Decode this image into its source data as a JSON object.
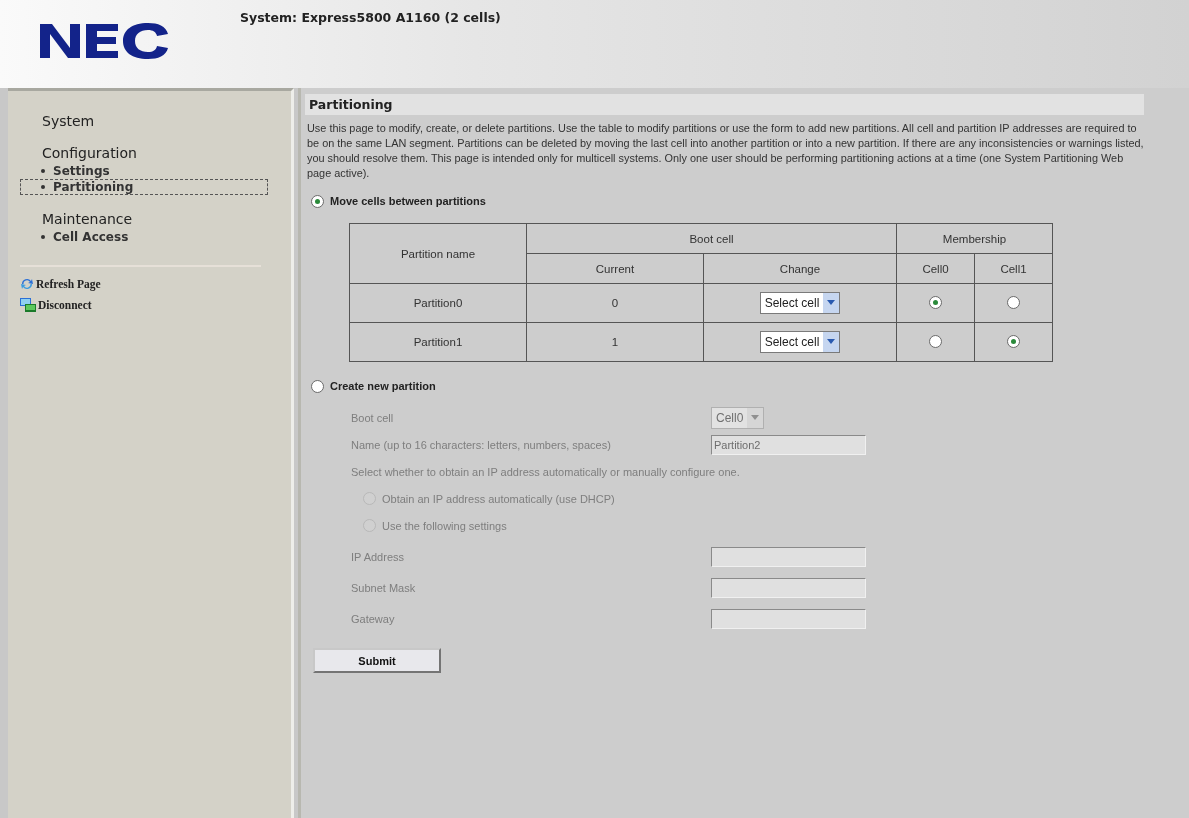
{
  "header": {
    "system_title": "System: Express5800 A1160 (2 cells)"
  },
  "sidebar": {
    "sections": [
      {
        "title": "System"
      },
      {
        "title": "Configuration",
        "items": [
          {
            "label": "Settings",
            "selected": false
          },
          {
            "label": "Partitioning",
            "selected": true
          }
        ]
      },
      {
        "title": "Maintenance",
        "items": [
          {
            "label": "Cell Access",
            "selected": false
          }
        ]
      }
    ],
    "actions": [
      {
        "label": "Refresh Page",
        "kind": "refresh"
      },
      {
        "label": "Disconnect",
        "kind": "disconnect"
      }
    ]
  },
  "main": {
    "heading": "Partitioning",
    "description": "Use this page to modify, create, or delete partitions. Use the table to modify partitions or use the form to add new partitions. All cell and partition IP addresses are required to be on the same LAN segment. Partitions can be deleted by moving the last cell into another partition or into a new partition. If there are any inconsistencies or warnings listed, you should resolve them. This page is intended only for multicell systems. Only one user should be performing partitioning actions at a time (one System Partitioning Web page active).",
    "move_option": {
      "label": "Move cells between partitions",
      "selected": true
    },
    "table": {
      "name_header": "Partition name",
      "boot_header": "Boot cell",
      "membership_header": "Membership",
      "current_header": "Current",
      "change_header": "Change",
      "cell_headers": [
        "Cell0",
        "Cell1"
      ],
      "rows": [
        {
          "name": "Partition0",
          "current": "0",
          "change": "Select cell",
          "cells": [
            true,
            false
          ]
        },
        {
          "name": "Partition1",
          "current": "1",
          "change": "Select cell",
          "cells": [
            false,
            true
          ]
        }
      ]
    },
    "create_option": {
      "label": "Create new partition",
      "selected": false,
      "disabled": true,
      "fields": [
        {
          "kind": "select",
          "label": "Boot cell",
          "value": "Cell0"
        },
        {
          "kind": "text",
          "label": "Name (up to 16 characters: letters, numbers, spaces)",
          "value": "Partition2"
        },
        {
          "kind": "note",
          "label": "Select whether to obtain an IP address automatically or manually configure one."
        },
        {
          "kind": "radio",
          "label": "Obtain an IP address automatically (use DHCP)",
          "selected": false
        },
        {
          "kind": "radio",
          "label": "Use the following settings",
          "selected": false
        },
        {
          "kind": "text",
          "label": "IP Address"
        },
        {
          "kind": "text",
          "label": "Subnet Mask"
        },
        {
          "kind": "text",
          "label": "Gateway"
        }
      ]
    },
    "submit": "Submit"
  }
}
